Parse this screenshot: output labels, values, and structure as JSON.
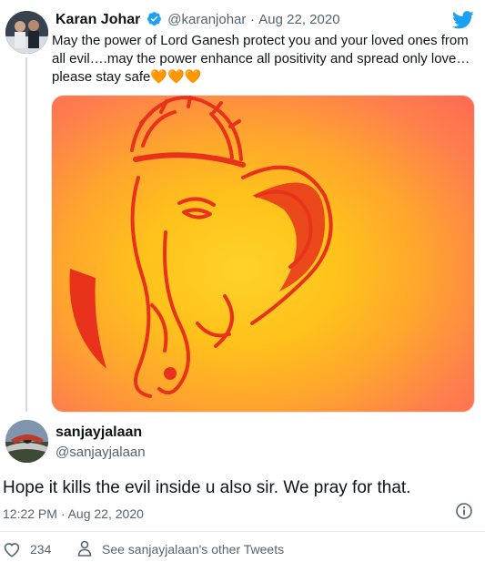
{
  "original_tweet": {
    "display_name": "Karan Johar",
    "handle": "@karanjohar",
    "separator": "·",
    "date": "Aug 22, 2020",
    "text": "May the power of Lord Ganesh protect you and your loved ones from all evil….may the power enhance all positivity and spread only love…please stay safe🧡🧡🧡",
    "verified": true,
    "brand_color": "#1da1f2"
  },
  "reply_tweet": {
    "display_name": "sanjayjalaan",
    "handle": "@sanjayjalaan",
    "text": "Hope it kills the evil inside u also sir. We pray for that.",
    "timestamp": "12:22 PM · Aug 22, 2020"
  },
  "actions": {
    "like_count": "234",
    "profile_link": "See sanjayjalaan's other Tweets"
  },
  "icons": {
    "twitter_logo": "twitter-bird-icon",
    "verified": "verified-badge-icon",
    "info": "info-icon",
    "like": "heart-icon",
    "person": "person-icon"
  }
}
